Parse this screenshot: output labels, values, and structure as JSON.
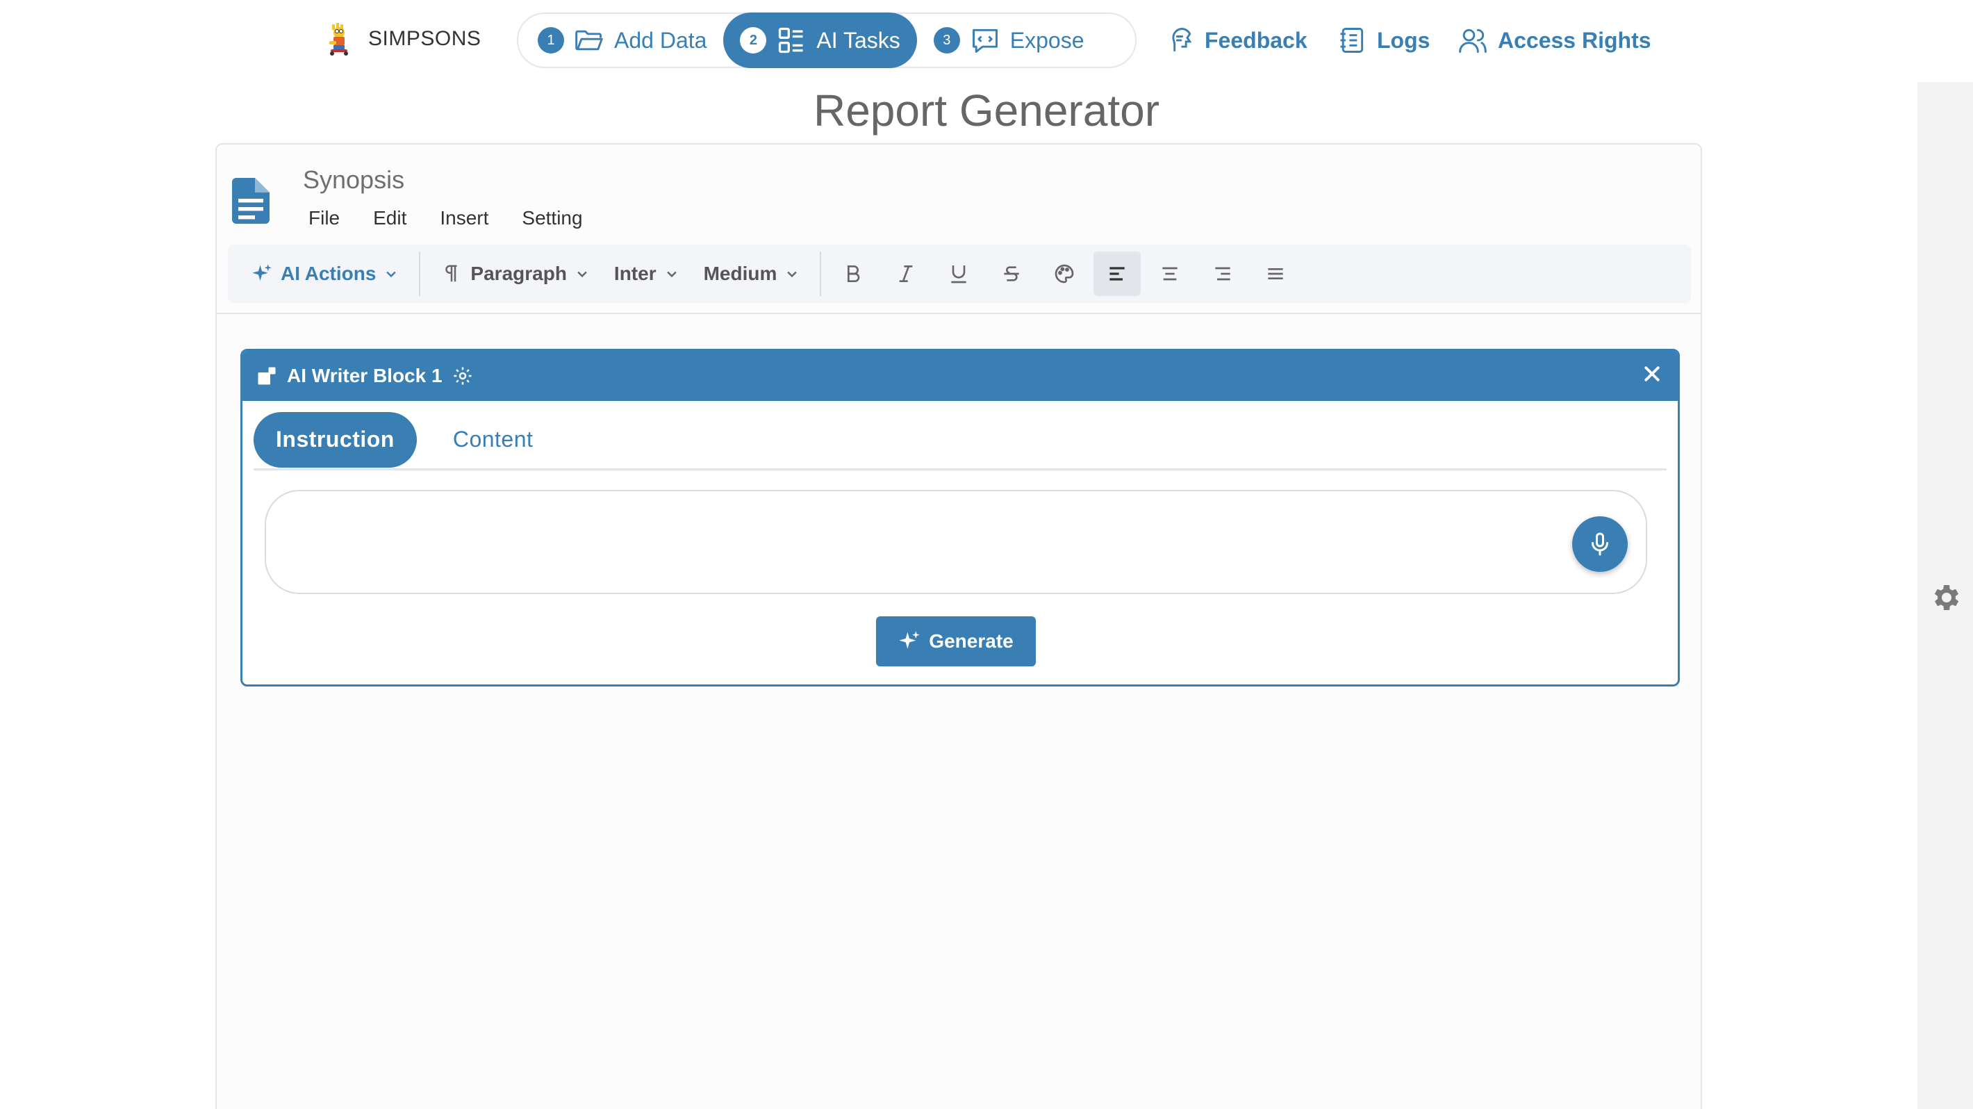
{
  "brand": {
    "name": "SIMPSONS"
  },
  "steps": [
    {
      "num": "1",
      "label": "Add Data",
      "icon": "folder-open-icon",
      "active": false
    },
    {
      "num": "2",
      "label": "AI Tasks",
      "icon": "grid-list-icon",
      "active": true
    },
    {
      "num": "3",
      "label": "Expose",
      "icon": "message-bubble-icon",
      "active": false
    }
  ],
  "nav": {
    "feedback": "Feedback",
    "logs": "Logs",
    "access_rights": "Access Rights"
  },
  "page": {
    "title": "Report Generator"
  },
  "document": {
    "name": "Synopsis",
    "menu": [
      "File",
      "Edit",
      "Insert",
      "Setting"
    ]
  },
  "toolbar": {
    "ai_actions": "AI Actions",
    "paragraph": "Paragraph",
    "font": "Inter",
    "weight": "Medium"
  },
  "ai_block": {
    "title": "AI Writer Block 1",
    "tabs": [
      "Instruction",
      "Content"
    ],
    "instruction_value": "",
    "generate_label": "Generate"
  },
  "colors": {
    "accent": "#3a7fb4",
    "toolbar_bg": "#f3f5f9",
    "title": "#666666"
  }
}
